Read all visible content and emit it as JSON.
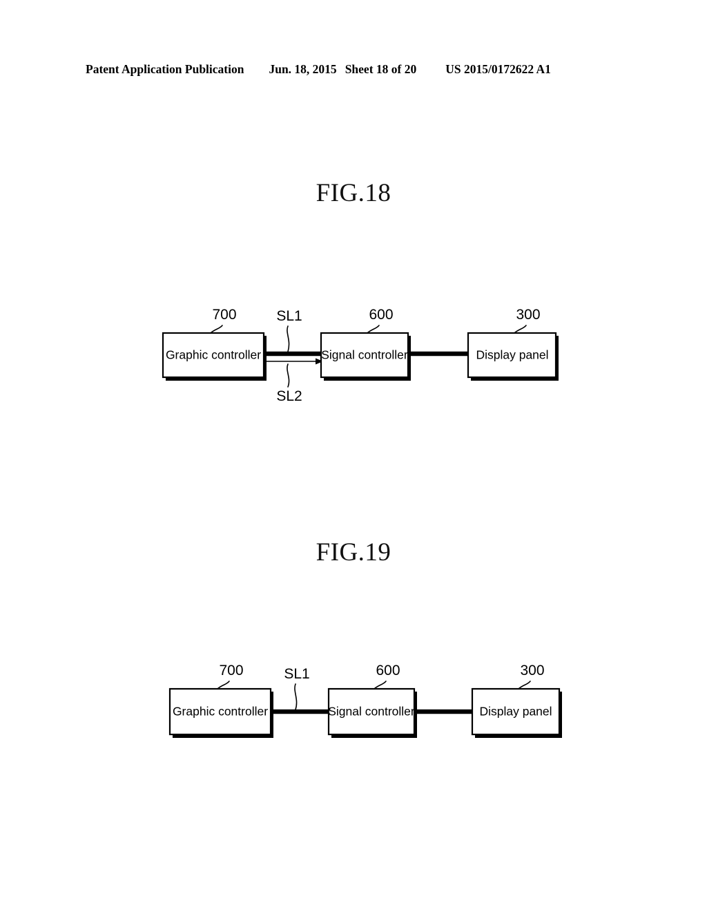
{
  "header": {
    "publication": "Patent Application Publication",
    "date": "Jun. 18, 2015",
    "sheet": "Sheet 18 of 20",
    "patent_number": "US 2015/0172622 A1"
  },
  "figures": [
    {
      "id": "fig18",
      "title": "FIG.18",
      "blocks": [
        {
          "label": "Graphic controller",
          "ref": "700"
        },
        {
          "label": "Signal controller",
          "ref": "600"
        },
        {
          "label": "Display panel",
          "ref": "300"
        }
      ],
      "signals": [
        {
          "name": "SL1",
          "style": "thick-bus",
          "from": "Graphic controller",
          "to": "Signal controller"
        },
        {
          "name": "SL2",
          "style": "thin-arrow",
          "from": "Graphic controller",
          "to": "Signal controller"
        }
      ],
      "unlabeled_links": [
        {
          "style": "thick-bus",
          "from": "Signal controller",
          "to": "Display panel"
        }
      ]
    },
    {
      "id": "fig19",
      "title": "FIG.19",
      "blocks": [
        {
          "label": "Graphic controller",
          "ref": "700"
        },
        {
          "label": "Signal controller",
          "ref": "600"
        },
        {
          "label": "Display panel",
          "ref": "300"
        }
      ],
      "signals": [
        {
          "name": "SL1",
          "style": "thick-bus",
          "from": "Graphic controller",
          "to": "Signal controller"
        }
      ],
      "unlabeled_links": [
        {
          "style": "thick-bus",
          "from": "Signal controller",
          "to": "Display panel"
        }
      ]
    }
  ],
  "colors": {
    "ink": "#000000",
    "paper": "#ffffff"
  }
}
